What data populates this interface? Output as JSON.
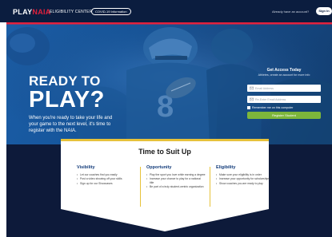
{
  "nav": {
    "brand_play": "PLAY",
    "brand_naia": "NAIA",
    "title": "ELIGIBILITY CENTER",
    "covid_button": "COVID-19 Information",
    "account_prompt": "Already have an account?",
    "signin_button": "Sign In"
  },
  "hero": {
    "title_line1": "READY TO",
    "title_line2": "PLAY?",
    "body": "When you're ready to take your life and your game to the next level, it's time to register with the NAIA."
  },
  "form": {
    "title": "Get Access Today",
    "subtitle": "Athletes, create an account for more info",
    "email_placeholder": "Email Address",
    "confirm_placeholder": "Re-Enter Email Address",
    "remember_label": "Remember me on this computer",
    "register_button": "Register Student"
  },
  "card": {
    "title": "Time to Suit Up",
    "columns": [
      {
        "heading": "Visibility",
        "items": [
          "Let our coaches find you easily",
          "Post a video showing off your skills",
          "Sign up for our Showcases"
        ]
      },
      {
        "heading": "Opportunity",
        "items": [
          "Play the sport you love while earning a degree",
          "Increase your chance to play for a national title",
          "Be part of a truly student-centric organization"
        ]
      },
      {
        "heading": "Eligibility",
        "items": [
          "Make sure your eligibility is in order",
          "Increase your opportunity for scholarships",
          "Show coaches you are ready to play"
        ]
      }
    ]
  },
  "colors": {
    "nav_bg": "#0b1d3f",
    "accent_red": "#e2213c",
    "hero_blue": "#1c5ea7",
    "register_green": "#7db63b",
    "card_yellow": "#e7c23a",
    "heading_blue": "#123b7a",
    "band_navy": "#0d1a3a"
  },
  "icons": {
    "email": "envelope-icon",
    "confirm": "envelope-icon"
  }
}
